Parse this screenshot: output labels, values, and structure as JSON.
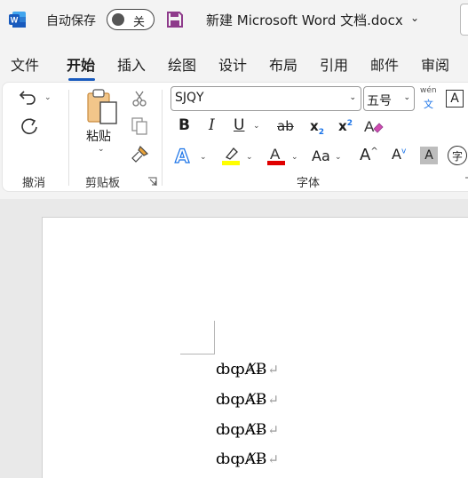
{
  "titlebar": {
    "app_logo_letter": "W",
    "autosave_label": "自动保存",
    "autosave_state": "关",
    "document_title": "新建 Microsoft Word 文档.docx",
    "title_chevron": "⌄"
  },
  "tabs": [
    {
      "label": "文件",
      "active": false
    },
    {
      "label": "开始",
      "active": true
    },
    {
      "label": "插入",
      "active": false
    },
    {
      "label": "绘图",
      "active": false
    },
    {
      "label": "设计",
      "active": false
    },
    {
      "label": "布局",
      "active": false
    },
    {
      "label": "引用",
      "active": false
    },
    {
      "label": "邮件",
      "active": false
    },
    {
      "label": "审阅",
      "active": false
    }
  ],
  "ribbon": {
    "undo_group_label": "撤消",
    "clipboard": {
      "paste_label": "粘贴",
      "group_label": "剪贴板"
    },
    "font": {
      "group_label": "字体",
      "font_name": "SJQY",
      "font_size": "五号",
      "phonetic_top": "wén",
      "phonetic_bottom": "文",
      "bold": "B",
      "italic": "I",
      "underline": "U",
      "strikethrough": "ab",
      "subscript": "x",
      "subscript_mark": "2",
      "superscript": "x",
      "superscript_mark": "2",
      "text_effect": "A",
      "font_color": "A",
      "change_case": "Aa",
      "grow_font": "A",
      "shrink_font": "A",
      "char_shading": "A",
      "enclose_char": "字",
      "char_border": "A",
      "highlight_color": "#ffff00",
      "font_color_value": "#e00000"
    }
  },
  "document": {
    "lines": [
      "ȸȹȺɃ",
      "ȸȹȺɃ",
      "ȸȹȺɃ",
      "ȸȹȺɃ"
    ],
    "paragraph_mark": "↵"
  }
}
